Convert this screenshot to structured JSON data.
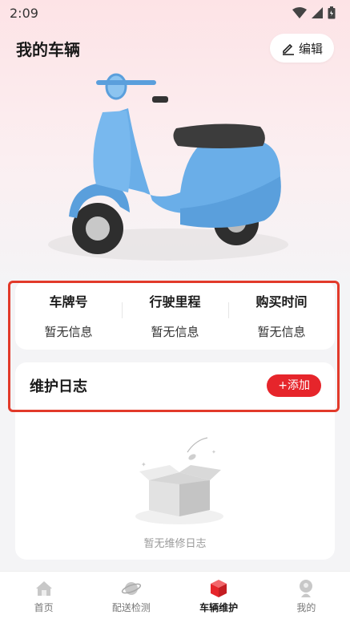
{
  "status_bar": {
    "time": "2:09"
  },
  "header": {
    "title": "我的车辆",
    "edit_label": "编辑"
  },
  "vehicle_info": [
    {
      "label": "车牌号",
      "value": "暂无信息"
    },
    {
      "label": "行驶里程",
      "value": "暂无信息"
    },
    {
      "label": "购买时间",
      "value": "暂无信息"
    }
  ],
  "maintenance_log": {
    "title": "维护日志",
    "add_label": "+添加",
    "empty_text": "暂无维修日志"
  },
  "tabs": [
    {
      "label": "首页",
      "icon": "home-icon",
      "active": false
    },
    {
      "label": "配送检测",
      "icon": "planet-icon",
      "active": false
    },
    {
      "label": "车辆维护",
      "icon": "cube-icon",
      "active": true
    },
    {
      "label": "我的",
      "icon": "profile-icon",
      "active": false
    }
  ],
  "colors": {
    "accent": "#e6252b",
    "highlight_border": "#e23a2a",
    "scooter": "#6aaee8"
  }
}
